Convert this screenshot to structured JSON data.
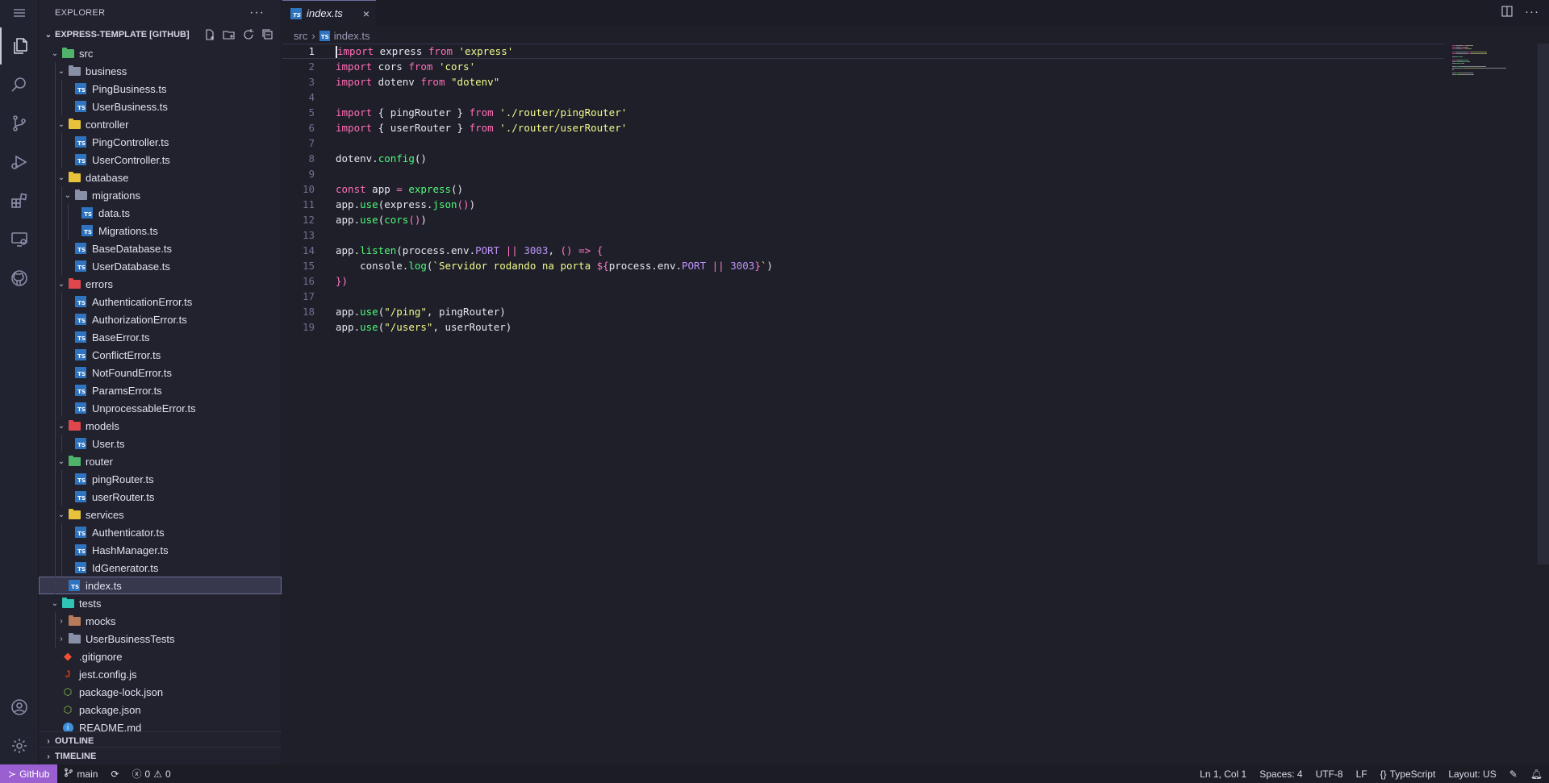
{
  "sidebar": {
    "title": "EXPLORER",
    "more": "···",
    "project": "EXPRESS-TEMPLATE [GITHUB]",
    "outline": "OUTLINE",
    "timeline": "TIMELINE",
    "tree": [
      {
        "label": "src",
        "depth": 1,
        "type": "folder",
        "open": true,
        "color": "#4fb36a"
      },
      {
        "label": "business",
        "depth": 2,
        "type": "folder",
        "open": true,
        "color": "#8a8fa8"
      },
      {
        "label": "PingBusiness.ts",
        "depth": 3,
        "type": "ts"
      },
      {
        "label": "UserBusiness.ts",
        "depth": 3,
        "type": "ts"
      },
      {
        "label": "controller",
        "depth": 2,
        "type": "folder",
        "open": true,
        "color": "#e8c23a"
      },
      {
        "label": "PingController.ts",
        "depth": 3,
        "type": "ts"
      },
      {
        "label": "UserController.ts",
        "depth": 3,
        "type": "ts"
      },
      {
        "label": "database",
        "depth": 2,
        "type": "folder",
        "open": true,
        "color": "#e8c23a"
      },
      {
        "label": "migrations",
        "depth": 3,
        "type": "folder",
        "open": true,
        "color": "#8a8fa8"
      },
      {
        "label": "data.ts",
        "depth": 4,
        "type": "ts"
      },
      {
        "label": "Migrations.ts",
        "depth": 4,
        "type": "ts"
      },
      {
        "label": "BaseDatabase.ts",
        "depth": 3,
        "type": "ts"
      },
      {
        "label": "UserDatabase.ts",
        "depth": 3,
        "type": "ts"
      },
      {
        "label": "errors",
        "depth": 2,
        "type": "folder",
        "open": true,
        "color": "#e0474c"
      },
      {
        "label": "AuthenticationError.ts",
        "depth": 3,
        "type": "ts"
      },
      {
        "label": "AuthorizationError.ts",
        "depth": 3,
        "type": "ts"
      },
      {
        "label": "BaseError.ts",
        "depth": 3,
        "type": "ts"
      },
      {
        "label": "ConflictError.ts",
        "depth": 3,
        "type": "ts"
      },
      {
        "label": "NotFoundError.ts",
        "depth": 3,
        "type": "ts"
      },
      {
        "label": "ParamsError.ts",
        "depth": 3,
        "type": "ts"
      },
      {
        "label": "UnprocessableError.ts",
        "depth": 3,
        "type": "ts"
      },
      {
        "label": "models",
        "depth": 2,
        "type": "folder",
        "open": true,
        "color": "#e0474c"
      },
      {
        "label": "User.ts",
        "depth": 3,
        "type": "ts"
      },
      {
        "label": "router",
        "depth": 2,
        "type": "folder",
        "open": true,
        "color": "#4fb36a"
      },
      {
        "label": "pingRouter.ts",
        "depth": 3,
        "type": "ts"
      },
      {
        "label": "userRouter.ts",
        "depth": 3,
        "type": "ts"
      },
      {
        "label": "services",
        "depth": 2,
        "type": "folder",
        "open": true,
        "color": "#e8c23a"
      },
      {
        "label": "Authenticator.ts",
        "depth": 3,
        "type": "ts"
      },
      {
        "label": "HashManager.ts",
        "depth": 3,
        "type": "ts"
      },
      {
        "label": "IdGenerator.ts",
        "depth": 3,
        "type": "ts"
      },
      {
        "label": "index.ts",
        "depth": 2,
        "type": "ts",
        "selected": true
      },
      {
        "label": "tests",
        "depth": 1,
        "type": "folder",
        "open": true,
        "color": "#2fc6b6"
      },
      {
        "label": "mocks",
        "depth": 2,
        "type": "folder",
        "open": false,
        "color": "#b57b5a"
      },
      {
        "label": "UserBusinessTests",
        "depth": 2,
        "type": "folder",
        "open": false,
        "color": "#8a8fa8"
      },
      {
        "label": ".gitignore",
        "depth": 1,
        "type": "git"
      },
      {
        "label": "jest.config.js",
        "depth": 1,
        "type": "jest"
      },
      {
        "label": "package-lock.json",
        "depth": 1,
        "type": "npm"
      },
      {
        "label": "package.json",
        "depth": 1,
        "type": "npm"
      },
      {
        "label": "README.md",
        "depth": 1,
        "type": "info"
      }
    ]
  },
  "editor": {
    "tab_label": "index.ts",
    "tab_close": "×",
    "breadcrumb": {
      "folder": "src",
      "sep": "›",
      "file": "index.ts"
    },
    "code_lines": [
      [
        [
          "kw",
          "import"
        ],
        [
          "t",
          " express "
        ],
        [
          "kw",
          "from"
        ],
        [
          "t",
          " "
        ],
        [
          "str",
          "'express'"
        ]
      ],
      [
        [
          "kw",
          "import"
        ],
        [
          "t",
          " cors "
        ],
        [
          "kw",
          "from"
        ],
        [
          "t",
          " "
        ],
        [
          "str",
          "'cors'"
        ]
      ],
      [
        [
          "kw",
          "import"
        ],
        [
          "t",
          " dotenv "
        ],
        [
          "kw",
          "from"
        ],
        [
          "t",
          " "
        ],
        [
          "str",
          "\"dotenv\""
        ]
      ],
      [],
      [
        [
          "kw",
          "import"
        ],
        [
          "t",
          " { pingRouter } "
        ],
        [
          "kw",
          "from"
        ],
        [
          "t",
          " "
        ],
        [
          "str",
          "'./router/pingRouter'"
        ]
      ],
      [
        [
          "kw",
          "import"
        ],
        [
          "t",
          " { userRouter } "
        ],
        [
          "kw",
          "from"
        ],
        [
          "t",
          " "
        ],
        [
          "str",
          "'./router/userRouter'"
        ]
      ],
      [],
      [
        [
          "t",
          "dotenv."
        ],
        [
          "fn",
          "config"
        ],
        [
          "t",
          "()"
        ]
      ],
      [],
      [
        [
          "kw",
          "const"
        ],
        [
          "t",
          " app "
        ],
        [
          "op",
          "="
        ],
        [
          "t",
          " "
        ],
        [
          "fn",
          "express"
        ],
        [
          "t",
          "()"
        ]
      ],
      [
        [
          "t",
          "app."
        ],
        [
          "fn",
          "use"
        ],
        [
          "t",
          "(express."
        ],
        [
          "fn",
          "json"
        ],
        [
          "op",
          "()"
        ],
        [
          "t",
          ")"
        ]
      ],
      [
        [
          "t",
          "app."
        ],
        [
          "fn",
          "use"
        ],
        [
          "t",
          "("
        ],
        [
          "fn",
          "cors"
        ],
        [
          "op",
          "()"
        ],
        [
          "t",
          ")"
        ]
      ],
      [],
      [
        [
          "t",
          "app."
        ],
        [
          "fn",
          "listen"
        ],
        [
          "t",
          "(process.env."
        ],
        [
          "num",
          "PORT"
        ],
        [
          "t",
          " "
        ],
        [
          "op",
          "||"
        ],
        [
          "t",
          " "
        ],
        [
          "num",
          "3003"
        ],
        [
          "t",
          ", "
        ],
        [
          "op",
          "() =>"
        ],
        [
          "t",
          " "
        ],
        [
          "op",
          "{"
        ]
      ],
      [
        [
          "t",
          "    console."
        ],
        [
          "fn",
          "log"
        ],
        [
          "t",
          "("
        ],
        [
          "str",
          "`Servidor rodando na porta "
        ],
        [
          "op",
          "${"
        ],
        [
          "t",
          "process.env."
        ],
        [
          "num",
          "PORT"
        ],
        [
          "t",
          " "
        ],
        [
          "op",
          "||"
        ],
        [
          "t",
          " "
        ],
        [
          "num",
          "3003"
        ],
        [
          "op",
          "}"
        ],
        [
          "str",
          "`"
        ],
        [
          "t",
          ")"
        ]
      ],
      [
        [
          "op",
          "})"
        ]
      ],
      [],
      [
        [
          "t",
          "app."
        ],
        [
          "fn",
          "use"
        ],
        [
          "t",
          "("
        ],
        [
          "str",
          "\"/ping\""
        ],
        [
          "t",
          ", pingRouter)"
        ]
      ],
      [
        [
          "t",
          "app."
        ],
        [
          "fn",
          "use"
        ],
        [
          "t",
          "("
        ],
        [
          "str",
          "\"/users\""
        ],
        [
          "t",
          ", userRouter)"
        ]
      ]
    ]
  },
  "statusbar": {
    "remote": "GitHub",
    "branch": "main",
    "errors": "0",
    "warnings": "0",
    "position": "Ln 1, Col 1",
    "spaces": "Spaces: 4",
    "encoding": "UTF-8",
    "eol": "LF",
    "language": "TypeScript",
    "layout": "Layout: US"
  },
  "colors": {
    "accent": "#9a5fd0",
    "ts_icon": "#2f74c0",
    "keyword": "#ff6fb7",
    "string": "#f1fa8c",
    "function": "#50fa7b",
    "number": "#bd93f9"
  }
}
